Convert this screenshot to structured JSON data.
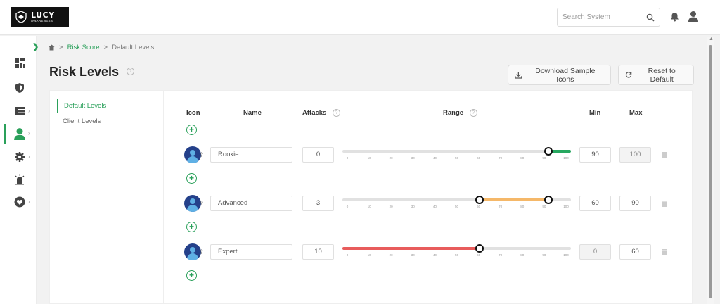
{
  "app": {
    "logo_title": "LUCY",
    "logo_subtitle": "AWARENESS"
  },
  "search": {
    "placeholder": "Search System"
  },
  "breadcrumb": {
    "link": "Risk Score",
    "current": "Default Levels"
  },
  "page": {
    "title": "Risk Levels"
  },
  "actions": {
    "download": "Download Sample Icons",
    "reset": "Reset to Default"
  },
  "subnav": {
    "items": [
      "Default Levels",
      "Client Levels"
    ]
  },
  "table": {
    "headers": {
      "icon": "Icon",
      "name": "Name",
      "attacks": "Attacks",
      "range": "Range",
      "min": "Min",
      "max": "Max"
    }
  },
  "ticks": [
    "0",
    "10",
    "20",
    "30",
    "40",
    "50",
    "60",
    "70",
    "80",
    "90",
    "100"
  ],
  "levels": [
    {
      "name": "Rookie",
      "attacks": "0",
      "min": "90",
      "max": "100",
      "color": "#27a860"
    },
    {
      "name": "Advanced",
      "attacks": "3",
      "min": "60",
      "max": "90",
      "color": "#f5b869"
    },
    {
      "name": "Expert",
      "attacks": "10",
      "min": "0",
      "max": "60",
      "color": "#e85c5c"
    }
  ],
  "colors": {
    "accent": "#2aa05a"
  },
  "icons": {
    "sidebar": [
      "dashboard-icon",
      "shield-icon",
      "campaigns-icon",
      "user-icon",
      "gear-icon",
      "alarm-icon",
      "heart-icon"
    ]
  }
}
